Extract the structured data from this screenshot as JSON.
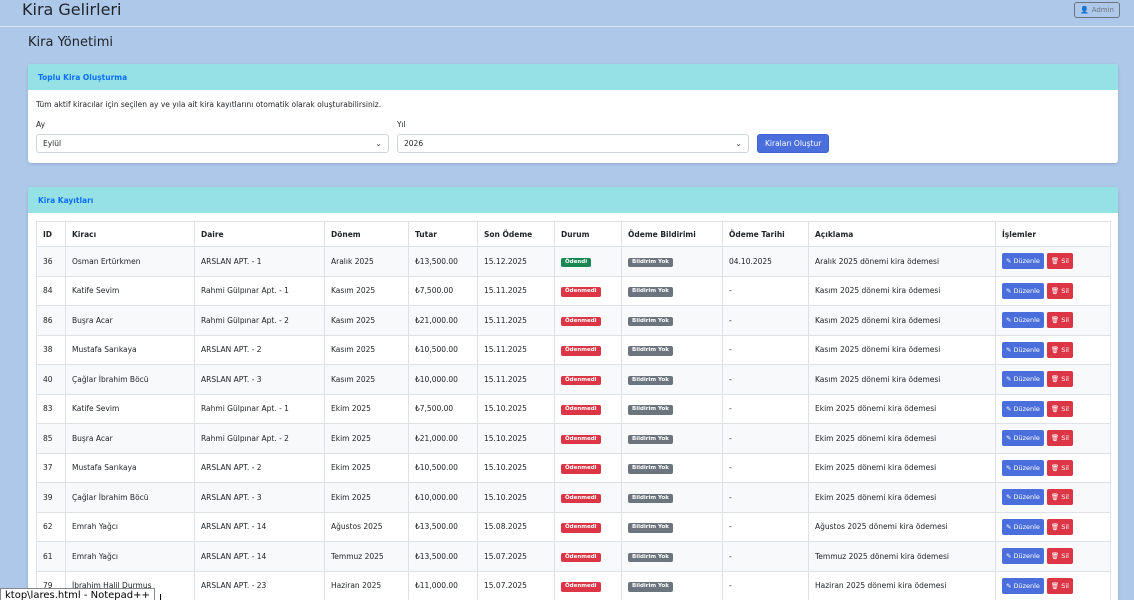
{
  "header": {
    "title": "Kira Gelirleri",
    "user_label": "Admin"
  },
  "section_title": "Kira Yönetimi",
  "bulk_card": {
    "title": "Toplu Kira Oluşturma",
    "description": "Tüm aktif kiracılar için seçilen ay ve yıla ait kira kayıtlarını otomatik olarak oluşturabilirsiniz.",
    "month_label": "Ay",
    "month_value": "Eylül",
    "year_label": "Yıl",
    "year_value": "2026",
    "submit_label": "Kiraları Oluştur"
  },
  "records_card": {
    "title": "Kira Kayıtları",
    "columns": [
      "ID",
      "Kiracı",
      "Daire",
      "Dönem",
      "Tutar",
      "Son Ödeme",
      "Durum",
      "Ödeme Bildirimi",
      "Ödeme Tarihi",
      "Açıklama",
      "İşlemler"
    ],
    "edit_label": "Düzenle",
    "delete_label": "Sil",
    "rows": [
      {
        "id": "36",
        "tenant": "Osman Ertürkmen",
        "unit": "ARSLAN APT. - 1",
        "period": "Aralık 2025",
        "amount": "₺13,500.00",
        "due": "15.12.2025",
        "status": "Ödendi",
        "status_type": "paid",
        "notice": "Bildirim Yok",
        "paid_date": "04.10.2025",
        "note": "Aralık 2025 dönemi kira ödemesi"
      },
      {
        "id": "84",
        "tenant": "Katife Sevim",
        "unit": "Rahmi Gülpınar Apt. - 1",
        "period": "Kasım 2025",
        "amount": "₺7,500.00",
        "due": "15.11.2025",
        "status": "Ödenmedi",
        "status_type": "unpaid",
        "notice": "Bildirim Yok",
        "paid_date": "-",
        "note": "Kasım 2025 dönemi kira ödemesi"
      },
      {
        "id": "86",
        "tenant": "Buşra Acar",
        "unit": "Rahmi Gülpınar Apt. - 2",
        "period": "Kasım 2025",
        "amount": "₺21,000.00",
        "due": "15.11.2025",
        "status": "Ödenmedi",
        "status_type": "unpaid",
        "notice": "Bildirim Yok",
        "paid_date": "-",
        "note": "Kasım 2025 dönemi kira ödemesi"
      },
      {
        "id": "38",
        "tenant": "Mustafa Sarıkaya",
        "unit": "ARSLAN APT. - 2",
        "period": "Kasım 2025",
        "amount": "₺10,500.00",
        "due": "15.11.2025",
        "status": "Ödenmedi",
        "status_type": "unpaid",
        "notice": "Bildirim Yok",
        "paid_date": "-",
        "note": "Kasım 2025 dönemi kira ödemesi"
      },
      {
        "id": "40",
        "tenant": "Çağlar İbrahim Böcü",
        "unit": "ARSLAN APT. - 3",
        "period": "Kasım 2025",
        "amount": "₺10,000.00",
        "due": "15.11.2025",
        "status": "Ödenmedi",
        "status_type": "unpaid",
        "notice": "Bildirim Yok",
        "paid_date": "-",
        "note": "Kasım 2025 dönemi kira ödemesi"
      },
      {
        "id": "83",
        "tenant": "Katife Sevim",
        "unit": "Rahmi Gülpınar Apt. - 1",
        "period": "Ekim 2025",
        "amount": "₺7,500.00",
        "due": "15.10.2025",
        "status": "Ödenmedi",
        "status_type": "unpaid",
        "notice": "Bildirim Yok",
        "paid_date": "-",
        "note": "Ekim 2025 dönemi kira ödemesi"
      },
      {
        "id": "85",
        "tenant": "Buşra Acar",
        "unit": "Rahmi Gülpınar Apt. - 2",
        "period": "Ekim 2025",
        "amount": "₺21,000.00",
        "due": "15.10.2025",
        "status": "Ödenmedi",
        "status_type": "unpaid",
        "notice": "Bildirim Yok",
        "paid_date": "-",
        "note": "Ekim 2025 dönemi kira ödemesi"
      },
      {
        "id": "37",
        "tenant": "Mustafa Sarıkaya",
        "unit": "ARSLAN APT. - 2",
        "period": "Ekim 2025",
        "amount": "₺10,500.00",
        "due": "15.10.2025",
        "status": "Ödenmedi",
        "status_type": "unpaid",
        "notice": "Bildirim Yok",
        "paid_date": "-",
        "note": "Ekim 2025 dönemi kira ödemesi"
      },
      {
        "id": "39",
        "tenant": "Çağlar İbrahim Böcü",
        "unit": "ARSLAN APT. - 3",
        "period": "Ekim 2025",
        "amount": "₺10,000.00",
        "due": "15.10.2025",
        "status": "Ödenmedi",
        "status_type": "unpaid",
        "notice": "Bildirim Yok",
        "paid_date": "-",
        "note": "Ekim 2025 dönemi kira ödemesi"
      },
      {
        "id": "62",
        "tenant": "Emrah Yağcı",
        "unit": "ARSLAN APT. - 14",
        "period": "Ağustos 2025",
        "amount": "₺13,500.00",
        "due": "15.08.2025",
        "status": "Ödenmedi",
        "status_type": "unpaid",
        "notice": "Bildirim Yok",
        "paid_date": "-",
        "note": "Ağustos 2025 dönemi kira ödemesi"
      },
      {
        "id": "61",
        "tenant": "Emrah Yağcı",
        "unit": "ARSLAN APT. - 14",
        "period": "Temmuz 2025",
        "amount": "₺13,500.00",
        "due": "15.07.2025",
        "status": "Ödenmedi",
        "status_type": "unpaid",
        "notice": "Bildirim Yok",
        "paid_date": "-",
        "note": "Temmuz 2025 dönemi kira ödemesi"
      },
      {
        "id": "79",
        "tenant": "İbrahim Halil Durmuş",
        "unit": "ARSLAN APT. - 23",
        "period": "Haziran 2025",
        "amount": "₺11,000.00",
        "due": "15.07.2025",
        "status": "Ödenmedi",
        "status_type": "unpaid",
        "notice": "Bildirim Yok",
        "paid_date": "-",
        "note": "Haziran 2025 dönemi kira ödemesi"
      }
    ]
  },
  "taskbar_tooltip": "ktop\\lares.html - Notepad++"
}
